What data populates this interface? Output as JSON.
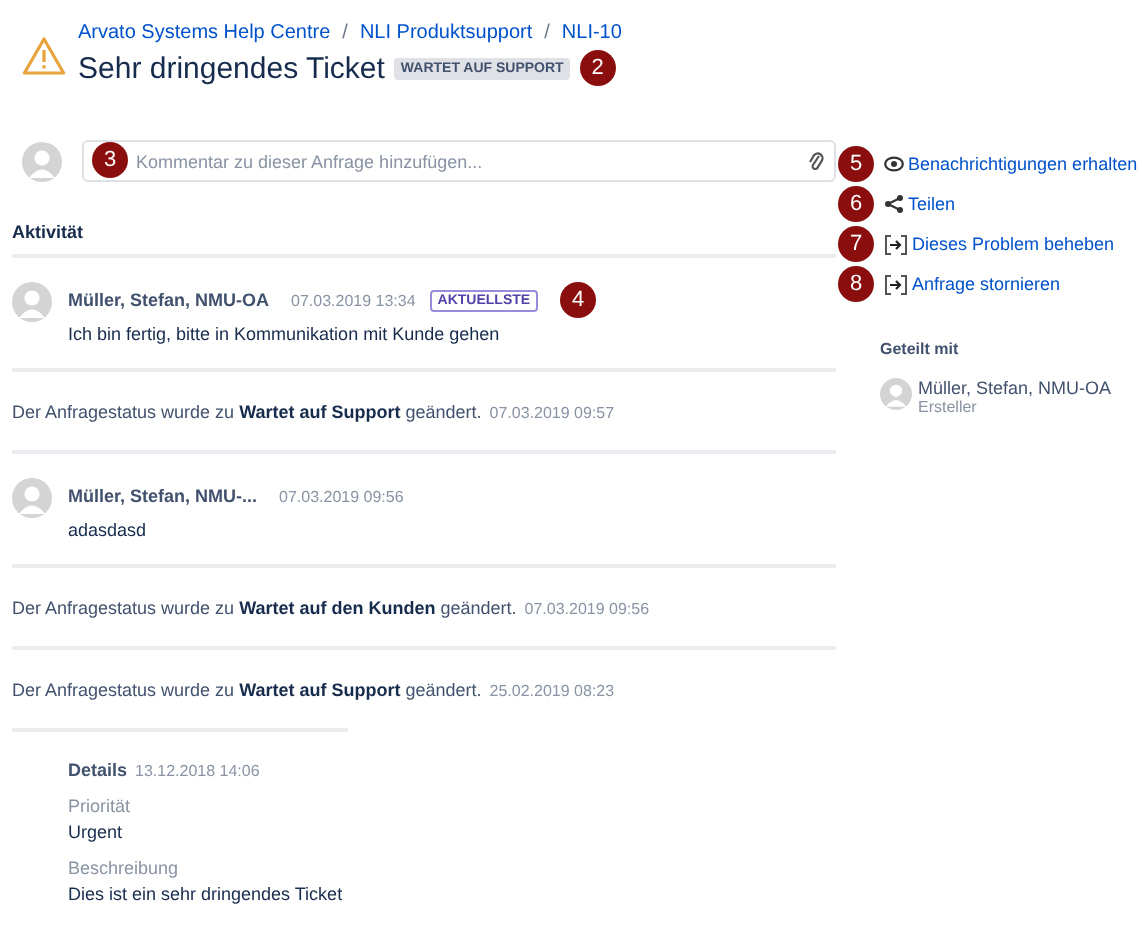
{
  "header": {
    "breadcrumb": [
      "Arvato Systems Help Centre",
      "NLI Produktsupport",
      "NLI-10"
    ],
    "separator": "/",
    "title": "Sehr dringendes Ticket",
    "status_badge": "WARTET AUF SUPPORT",
    "marker": "2"
  },
  "comment_box": {
    "placeholder": "Kommentar zu dieser Anfrage hinzufügen...",
    "marker": "3"
  },
  "activity": {
    "heading": "Aktivität",
    "items": [
      {
        "kind": "comment",
        "author": "Müller, Stefan, NMU-OA",
        "time": "07.03.2019 13:34",
        "badge": "AKTUELLSTE",
        "marker": "4",
        "text": "Ich bin fertig, bitte in Kommunikation mit Kunde gehen"
      },
      {
        "kind": "status",
        "text": "Der Anfragestatus wurde zu **Wartet auf Support** geändert.",
        "time": "07.03.2019 09:57"
      },
      {
        "kind": "comment",
        "author": "Müller, Stefan, NMU-...",
        "time": "07.03.2019 09:56",
        "text": "adasdasd"
      },
      {
        "kind": "status",
        "text": "Der Anfragestatus wurde zu **Wartet auf den Kunden** geändert.",
        "time": "07.03.2019 09:56"
      },
      {
        "kind": "status",
        "text": "Der Anfragestatus wurde zu **Wartet auf Support** geändert.",
        "time": "25.02.2019 08:23"
      }
    ]
  },
  "details": {
    "heading": "Details",
    "time": "13.12.2018 14:06",
    "fields": [
      {
        "label": "Priorität",
        "value": "Urgent"
      },
      {
        "label": "Beschreibung",
        "value": "Dies ist ein sehr dringendes Ticket"
      }
    ]
  },
  "actions": [
    {
      "kind": "watch",
      "label": "Benachrichtigungen erhalten",
      "marker": "5"
    },
    {
      "kind": "share",
      "label": "Teilen",
      "marker": "6"
    },
    {
      "kind": "transition",
      "label": "Dieses Problem beheben",
      "marker": "7"
    },
    {
      "kind": "transition",
      "label": "Anfrage stornieren",
      "marker": "8"
    }
  ],
  "shared": {
    "heading": "Geteilt mit",
    "people": [
      {
        "name": "Müller, Stefan, NMU-OA",
        "role": "Ersteller"
      }
    ]
  }
}
